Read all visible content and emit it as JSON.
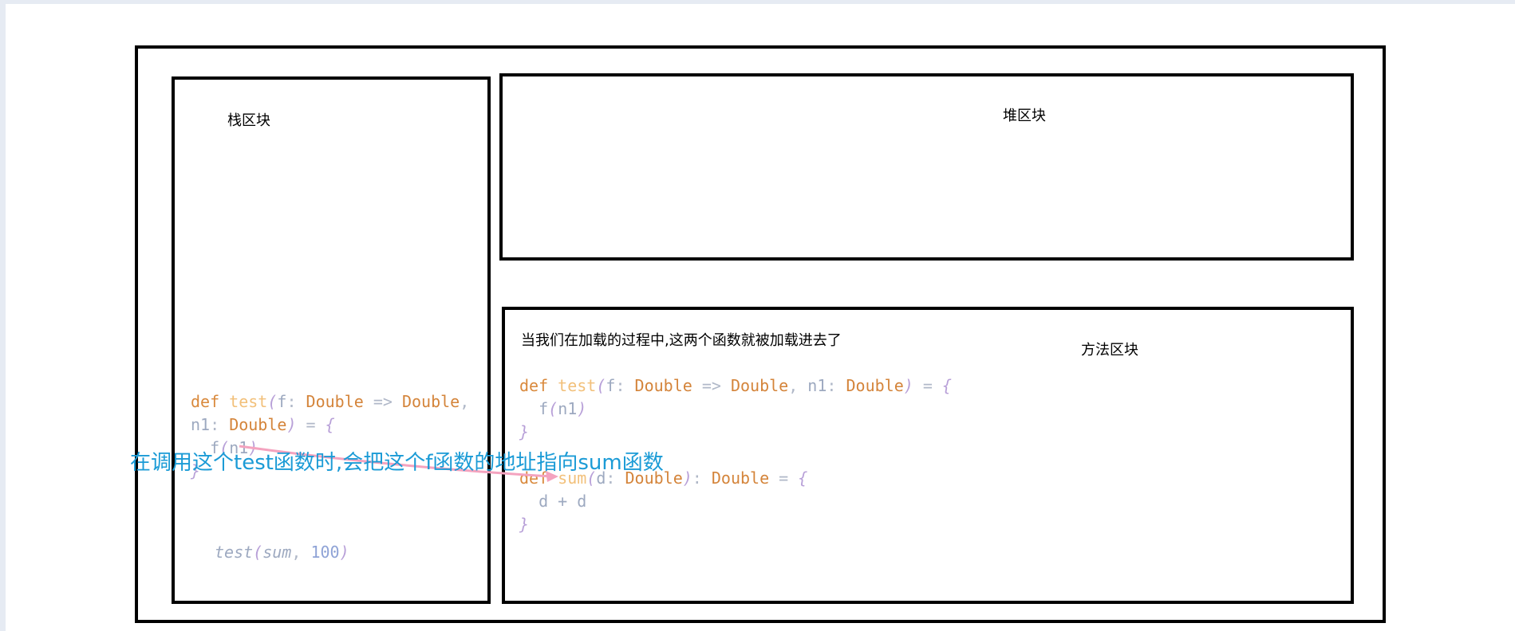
{
  "stack": {
    "label": "栈区块",
    "code": {
      "l1_def": "def ",
      "l1_name": "test",
      "l1_paren": "(",
      "l1_param": "f",
      "l1_colon": ": ",
      "l1_type1": "Double",
      "l1_arrow": " => ",
      "l1_type2": "Double",
      "l1_comma": ",",
      "l2_param": "n1",
      "l2_colon": ": ",
      "l2_type": "Double",
      "l2_close": ")",
      "l2_eq": " = ",
      "l2_brace": "{",
      "l3_fn": "f",
      "l3_open": "(",
      "l3_arg": "n1",
      "l3_close": ")",
      "l4_brace": "}"
    },
    "call": {
      "name": "test",
      "open": "(",
      "arg1": "sum",
      "comma": ", ",
      "arg2": "100",
      "close": ")"
    }
  },
  "heap": {
    "label": "堆区块"
  },
  "method": {
    "label": "方法区块",
    "note": "当我们在加载的过程中,这两个函数就被加载进去了",
    "test_code": {
      "l1_def": "def ",
      "l1_name": "test",
      "l1_paren": "(",
      "l1_param": "f",
      "l1_colon": ": ",
      "l1_type1": "Double",
      "l1_arrow": " => ",
      "l1_type2": "Double",
      "l1_comma": ", ",
      "l1_param2": "n1",
      "l1_colon2": ": ",
      "l1_type3": "Double",
      "l1_close": ")",
      "l1_eq": " = ",
      "l1_brace": "{",
      "l2_fn": "f",
      "l2_open": "(",
      "l2_arg": "n1",
      "l2_close": ")",
      "l3_brace": "}"
    },
    "sum_code": {
      "l1_def": "def ",
      "l1_name": "sum",
      "l1_paren": "(",
      "l1_param": "d",
      "l1_colon": ": ",
      "l1_type1": "Double",
      "l1_close": ")",
      "l1_colon2": ": ",
      "l1_type2": "Double",
      "l1_eq": " = ",
      "l1_brace": "{",
      "l2_body": "d + d",
      "l3_brace": "}"
    }
  },
  "annotation": {
    "text": "在调用这个test函数时,会把这个f函数的地址指向sum函数",
    "color": "#1b9bd6"
  },
  "colors": {
    "border": "#000000",
    "arrow": "#f4a3bf",
    "keyword": "#d9893c",
    "type": "#d4843a",
    "param": "#9da9c0"
  }
}
